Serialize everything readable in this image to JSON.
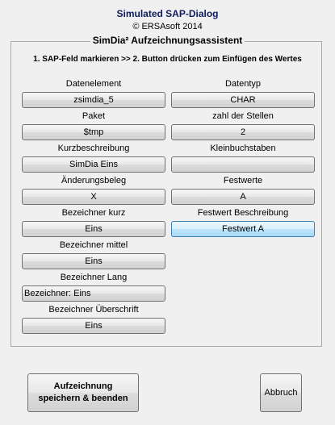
{
  "header": {
    "title": "Simulated SAP-Dialog",
    "copyright": "© ERSAsoft 2014"
  },
  "group": {
    "title": "SimDia² Aufzeichnungsassistent",
    "instruction": "1. SAP-Feld markieren >> 2. Button drücken zum Einfügen des Wertes"
  },
  "left_fields": [
    {
      "label": "Datenelement",
      "value": "zsimdia_5"
    },
    {
      "label": "Paket",
      "value": "$tmp"
    },
    {
      "label": "Kurzbeschreibung",
      "value": "SimDia Eins"
    },
    {
      "label": "Änderungsbeleg",
      "value": "X"
    },
    {
      "label": "Bezeichner kurz",
      "value": "Eins"
    },
    {
      "label": "Bezeichner mittel",
      "value": "Eins"
    },
    {
      "label": "Bezeichner Lang",
      "value": "Bezeichner: Eins"
    },
    {
      "label": "Bezeichner Überschrift",
      "value": "Eins"
    }
  ],
  "right_fields": [
    {
      "label": "Datentyp",
      "value": "CHAR"
    },
    {
      "label": "zahl der Stellen",
      "value": "2"
    },
    {
      "label": "Kleinbuchstaben",
      "value": ""
    },
    {
      "label": "Festwerte",
      "value": "A"
    },
    {
      "label": "Festwert Beschreibung",
      "value": "Festwert A"
    }
  ],
  "footer": {
    "save_line1": "Aufzeichnung",
    "save_line2": "speichern & beenden",
    "cancel_label": "Abbruch"
  },
  "colors": {
    "title": "#0e1d5e",
    "highlight_border": "#3c7fb1",
    "highlight_fill": "#bee6fd"
  }
}
